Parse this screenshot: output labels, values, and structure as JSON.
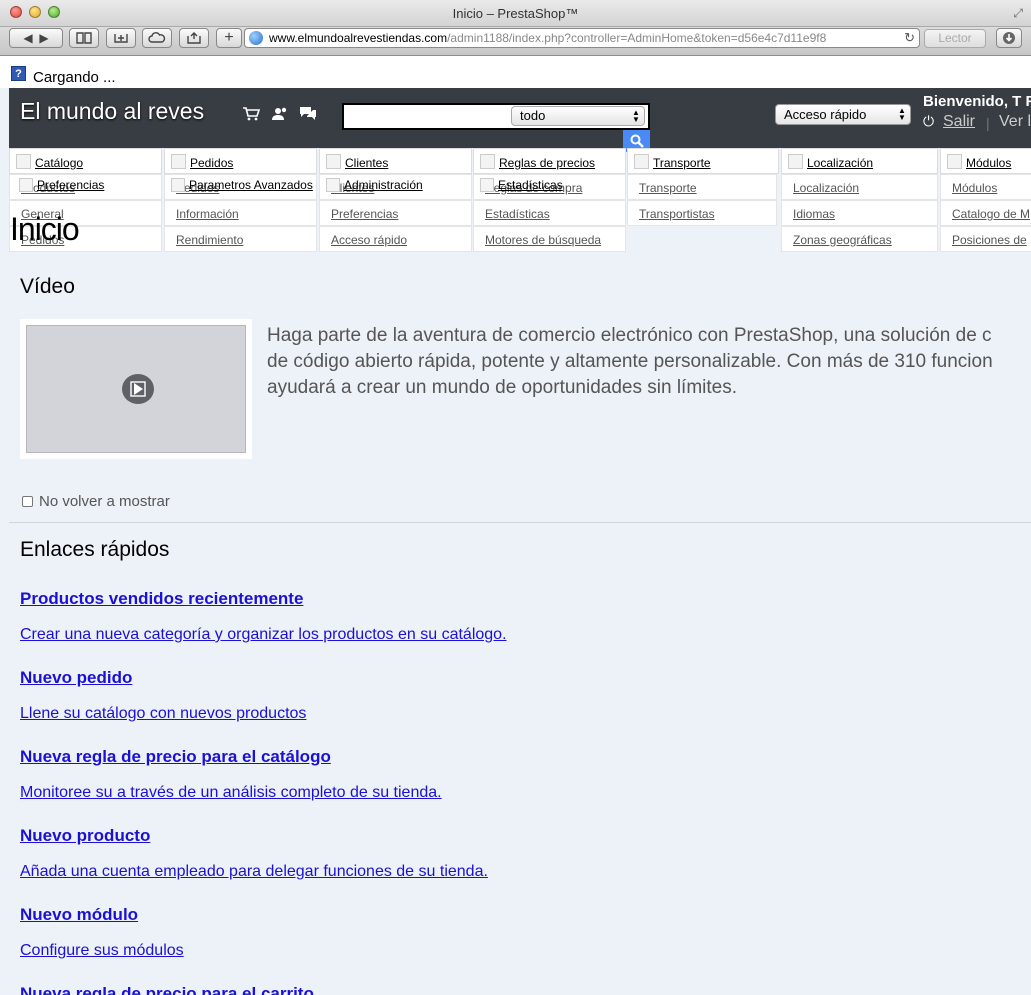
{
  "window": {
    "title": "Inicio – PrestaShop™"
  },
  "toolbar": {
    "url_host": "www.elmundoalrevestiendas.com",
    "url_path": "/admin1188/index.php?controller=AdminHome&token=d56e4c7d11e9f8",
    "reader_label": "Lector"
  },
  "loading": {
    "text": "Cargando ..."
  },
  "header": {
    "shop_name": "El mundo al reves",
    "search_scope": "todo",
    "quick_access": "Acceso rápido",
    "welcome": "Bienvenido, T F",
    "logout": "Salir",
    "view_shop": "Ver l"
  },
  "menu": [
    {
      "tab": "Catálogo",
      "subs": [
        "Productos",
        "General",
        "Pedidos"
      ]
    },
    {
      "tab": "Pedidos",
      "subs": [
        "Pedidos",
        "Información",
        "Rendimiento"
      ]
    },
    {
      "tab": "Clientes",
      "subs": [
        "Clientes",
        "Preferencias",
        "Acceso rápido"
      ]
    },
    {
      "tab": "Reglas de precios",
      "subs": [
        "Reglas de compra",
        "Estadísticas",
        "Motores de búsqueda"
      ]
    },
    {
      "tab": "Transporte",
      "subs": [
        "Transporte",
        "Transportistas"
      ]
    },
    {
      "tab": "Localización",
      "subs": [
        "Localización",
        "Idiomas",
        "Zonas geográficas"
      ]
    },
    {
      "tab": "Módulos",
      "subs": [
        "Módulos",
        "Catalogo de M",
        "Posiciones de "
      ]
    }
  ],
  "menu_overlay": {
    "preferencias": "Preferencias",
    "parametros": "Parametros Avanzados",
    "administracion": "Administración",
    "estadisticas": "Estadísticas"
  },
  "page_title": "Inicio",
  "video": {
    "heading": "Vídeo",
    "description": "Haga parte de la aventura de comercio electrónico con PrestaShop, una solución de c de código abierto rápida, potente y altamente personalizable. Con más de 310 funcion ayudará a crear un mundo de oportunidades sin límites.",
    "desc_line1": "Haga parte de la aventura de comercio electrónico con PrestaShop, una solución de c",
    "desc_line2": "de código abierto rápida, potente y altamente personalizable. Con más de 310 funcion",
    "desc_line3": "ayudará a crear un mundo de oportunidades sin límites.",
    "no_show": "No volver a mostrar"
  },
  "quick_links": {
    "heading": "Enlaces rápidos",
    "items": [
      {
        "title": "Productos vendidos recientemente",
        "desc": "Crear una nueva categoría y organizar los productos en su catálogo."
      },
      {
        "title": "Nuevo pedido",
        "desc": "Llene su catálogo con nuevos productos"
      },
      {
        "title": "Nueva regla de precio para el catálogo",
        "desc": "Monitoree su a través de un análisis completo de su tienda."
      },
      {
        "title": "Nuevo producto",
        "desc": "Añada una cuenta empleado para delegar funciones de su tienda."
      },
      {
        "title": "Nuevo módulo",
        "desc": "Configure sus módulos"
      },
      {
        "title": "Nueva regla de precio para el carrito",
        "desc": ""
      }
    ]
  },
  "colors": {
    "header_bg": "#383d43",
    "page_bg": "#edf1f8",
    "link": "#1b10d6",
    "search_button": "#4a8af4"
  }
}
